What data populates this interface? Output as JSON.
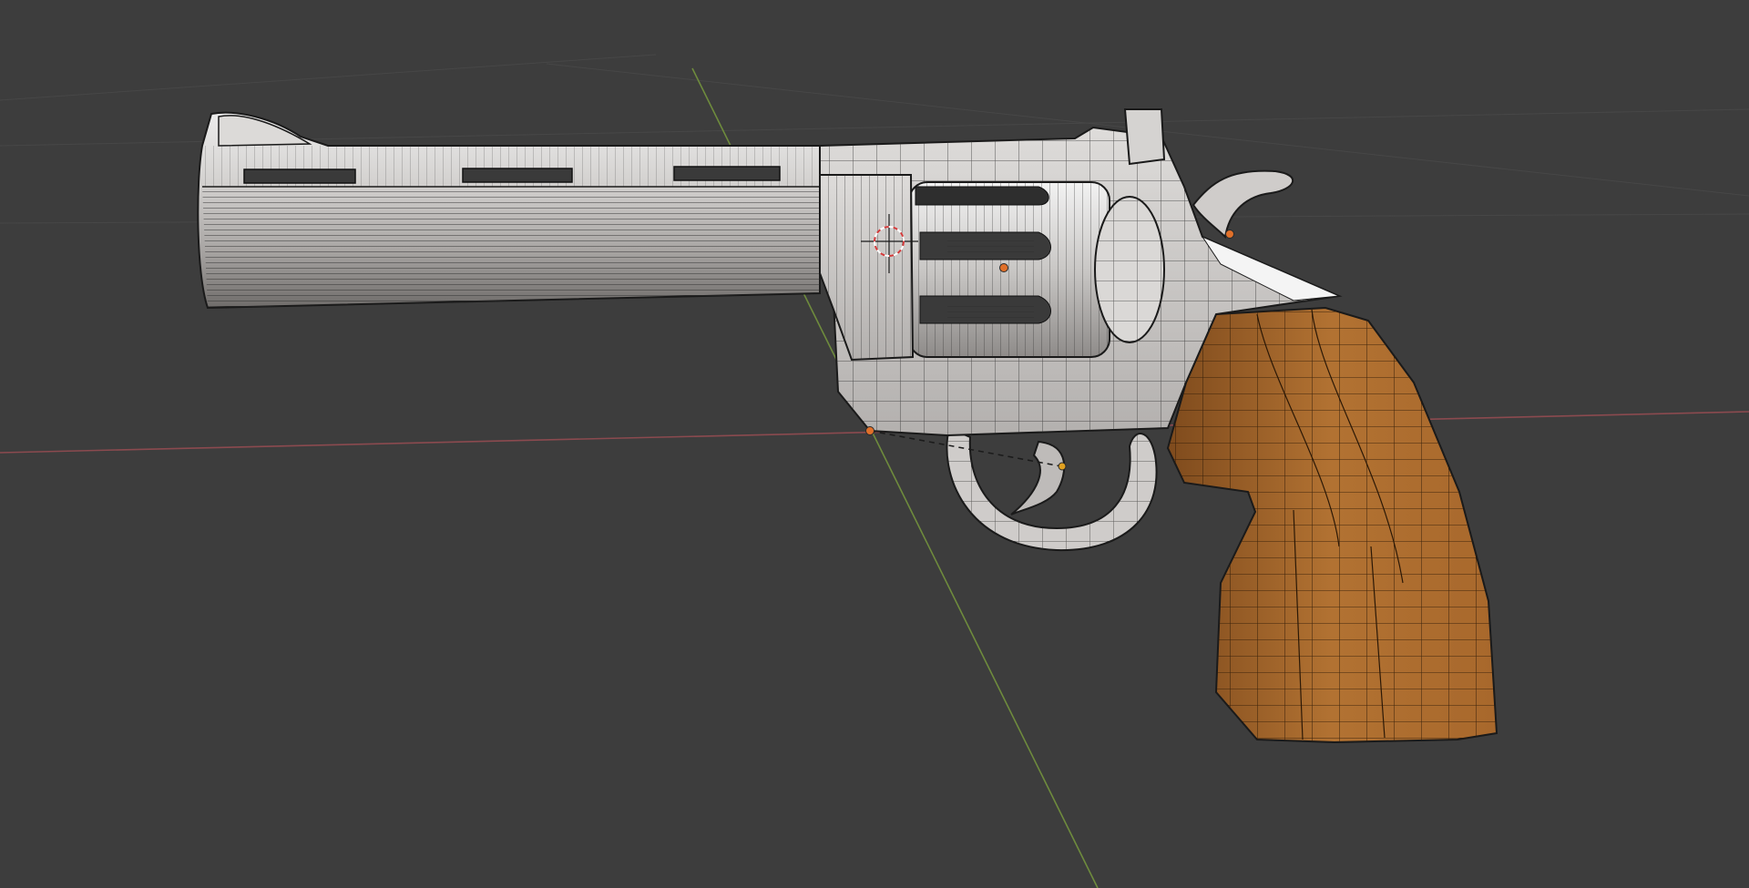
{
  "viewport": {
    "background": "#3d3d3d",
    "grid_color": "#474747",
    "x_axis_color": "#8b4a4f",
    "y_axis_color": "#6e8b3d"
  },
  "model": {
    "object": "revolver",
    "metal_color": "#c9c7c6",
    "metal_dark": "#8e8b89",
    "grip_color": "#a8682c",
    "grip_dark": "#7b4a1f",
    "wire_color": "#1a1a1a"
  },
  "markers": {
    "origin_color": "#e0702a",
    "cursor_color": "#d23a3a",
    "cursor_icon": "3d-cursor-icon"
  }
}
